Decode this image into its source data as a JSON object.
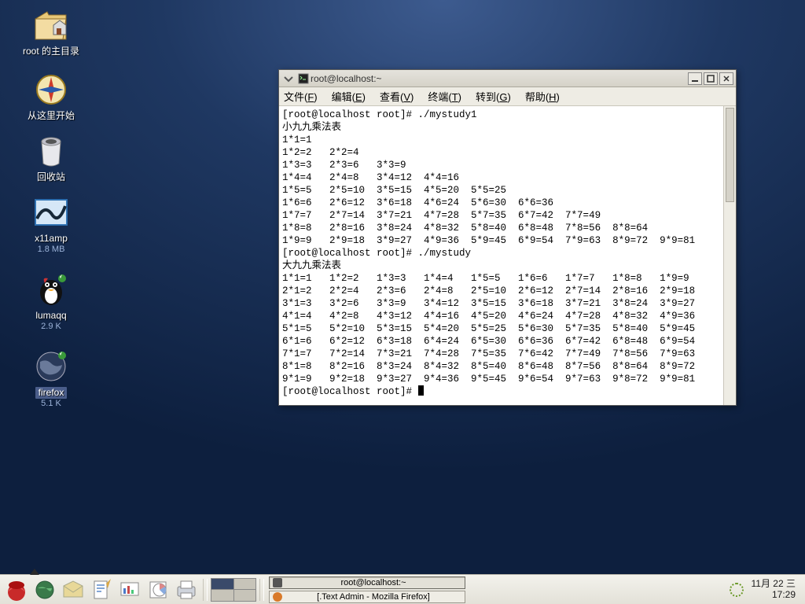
{
  "desktop": {
    "icons": [
      {
        "label": "root 的主目录",
        "sub": ""
      },
      {
        "label": "从这里开始",
        "sub": ""
      },
      {
        "label": "回收站",
        "sub": ""
      },
      {
        "label": "x11amp",
        "sub": "1.8 MB"
      },
      {
        "label": "lumaqq",
        "sub": "2.9 K"
      },
      {
        "label": "firefox",
        "sub": "5.1 K"
      }
    ]
  },
  "window": {
    "title": "root@localhost:~",
    "menu": {
      "file": "文件(F)",
      "edit": "编辑(E)",
      "view": "查看(V)",
      "terminal": "终端(T)",
      "go": "转到(G)",
      "help": "帮助(H)"
    }
  },
  "terminal": {
    "prompt1": "[root@localhost root]# ./mystudy1",
    "title1": "小九九乘法表",
    "table1": [
      "1*1=1",
      "1*2=2   2*2=4",
      "1*3=3   2*3=6   3*3=9",
      "1*4=4   2*4=8   3*4=12  4*4=16",
      "1*5=5   2*5=10  3*5=15  4*5=20  5*5=25",
      "1*6=6   2*6=12  3*6=18  4*6=24  5*6=30  6*6=36",
      "1*7=7   2*7=14  3*7=21  4*7=28  5*7=35  6*7=42  7*7=49",
      "1*8=8   2*8=16  3*8=24  4*8=32  5*8=40  6*8=48  7*8=56  8*8=64",
      "1*9=9   2*9=18  3*9=27  4*9=36  5*9=45  6*9=54  7*9=63  8*9=72  9*9=81"
    ],
    "prompt2": "[root@localhost root]# ./mystudy",
    "title2": "大九九乘法表",
    "table2": [
      "1*1=1   1*2=2   1*3=3   1*4=4   1*5=5   1*6=6   1*7=7   1*8=8   1*9=9",
      "2*1=2   2*2=4   2*3=6   2*4=8   2*5=10  2*6=12  2*7=14  2*8=16  2*9=18",
      "3*1=3   3*2=6   3*3=9   3*4=12  3*5=15  3*6=18  3*7=21  3*8=24  3*9=27",
      "4*1=4   4*2=8   4*3=12  4*4=16  4*5=20  4*6=24  4*7=28  4*8=32  4*9=36",
      "5*1=5   5*2=10  5*3=15  5*4=20  5*5=25  5*6=30  5*7=35  5*8=40  5*9=45",
      "6*1=6   6*2=12  6*3=18  6*4=24  6*5=30  6*6=36  6*7=42  6*8=48  6*9=54",
      "7*1=7   7*2=14  7*3=21  7*4=28  7*5=35  7*6=42  7*7=49  7*8=56  7*9=63",
      "8*1=8   8*2=16  8*3=24  8*4=32  8*5=40  8*6=48  8*7=56  8*8=64  8*9=72",
      "9*1=9   9*2=18  9*3=27  9*4=36  9*5=45  9*6=54  9*7=63  9*8=72  9*9=81"
    ],
    "prompt3": "[root@localhost root]# "
  },
  "taskbar": {
    "tasks": [
      "root@localhost:~",
      "[.Text Admin - Mozilla Firefox]"
    ],
    "date": "11月 22 三",
    "time": "17:29"
  }
}
